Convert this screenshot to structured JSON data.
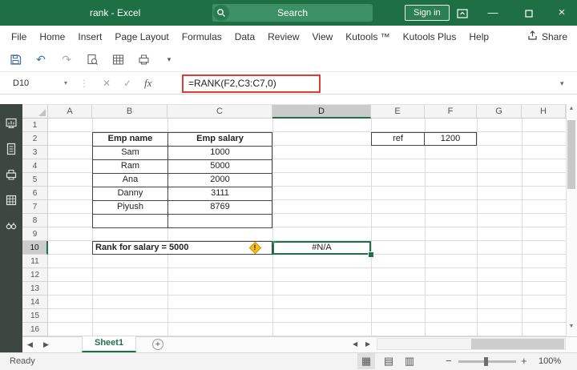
{
  "colors": {
    "accent_green": "#217346",
    "titlebar_green": "#1E7044",
    "selection_border": "#1F7246",
    "formula_highlight_border": "#E23B33",
    "warning_yellow": "#F2BE19"
  },
  "titlebar": {
    "title": "rank - Excel",
    "search_placeholder": "Search",
    "sign_in_label": "Sign in"
  },
  "ribbon": {
    "tabs": [
      "File",
      "Home",
      "Insert",
      "Page Layout",
      "Formulas",
      "Data",
      "Review",
      "View",
      "Kutools ™",
      "Kutools Plus",
      "Help"
    ],
    "share_label": "Share"
  },
  "formula_bar": {
    "name_box": "D10",
    "fx_label": "fx",
    "formula": "=RANK(F2,C3:C7,0)"
  },
  "grid": {
    "columns": [
      "A",
      "B",
      "C",
      "D",
      "E",
      "F",
      "G",
      "H"
    ],
    "rows": [
      "1",
      "2",
      "3",
      "4",
      "5",
      "6",
      "7",
      "8",
      "9",
      "10",
      "11",
      "12",
      "13",
      "14",
      "15",
      "16"
    ],
    "selected_cell": "D10",
    "emp_table": {
      "name_header": "Emp name",
      "salary_header": "Emp salary",
      "rows": [
        {
          "name": "Sam",
          "salary": "1000"
        },
        {
          "name": "Ram",
          "salary": "5000"
        },
        {
          "name": "Ana",
          "salary": "2000"
        },
        {
          "name": "Danny",
          "salary": "3111"
        },
        {
          "name": "Piyush",
          "salary": "8769"
        }
      ]
    },
    "ref": {
      "label": "ref",
      "value": "1200"
    },
    "rank_label": "Rank for salary = 5000",
    "result_value": "#N/A"
  },
  "sheet_tabs": {
    "active_tab": "Sheet1"
  },
  "status_bar": {
    "mode": "Ready",
    "zoom_level": "100%"
  }
}
